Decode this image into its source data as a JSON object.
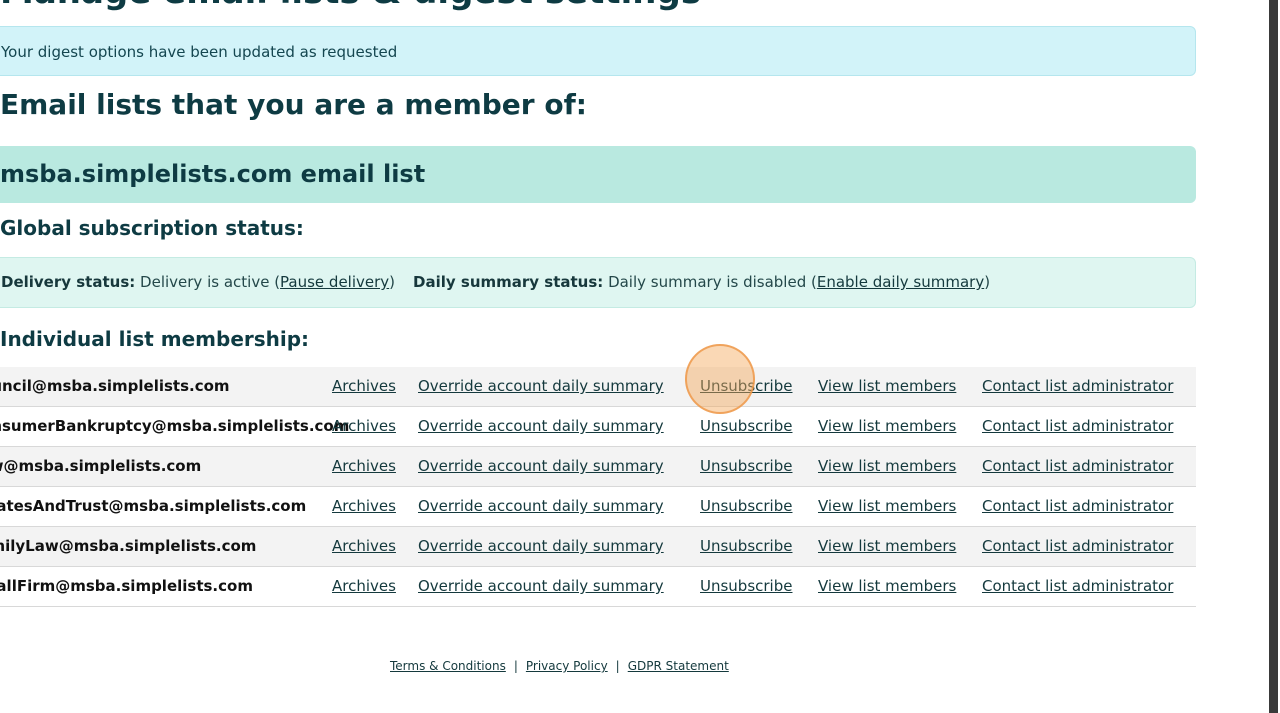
{
  "header": {
    "title_partial": "Manage email lists & digest settings"
  },
  "alert": {
    "text": "Your digest options have been updated as requested"
  },
  "sections": {
    "lists_heading": "Email lists that you are a member of:",
    "list_banner": "msba.simplelists.com email list",
    "subscription_heading": "Global subscription status:",
    "membership_heading": "Individual list membership:"
  },
  "status": {
    "delivery_label": "Delivery status:",
    "delivery_text": "Delivery is active",
    "pause_link": "Pause delivery",
    "summary_label": "Daily summary status:",
    "summary_text": "Daily summary is disabled",
    "enable_link": "Enable daily summary"
  },
  "rows": [
    {
      "email": "Council@msba.simplelists.com",
      "archives": "Archives",
      "override": "Override account daily summary",
      "unsubscribe": "Unsubscribe",
      "view": "View list members",
      "contact": "Contact list administrator"
    },
    {
      "email": "ConsumerBankruptcy@msba.simplelists.com",
      "archives": "Archives",
      "override": "Override account daily summary",
      "unsubscribe": "Unsubscribe",
      "view": "View list members",
      "contact": "Contact list administrator"
    },
    {
      "email": "Law@msba.simplelists.com",
      "archives": "Archives",
      "override": "Override account daily summary",
      "unsubscribe": "Unsubscribe",
      "view": "View list members",
      "contact": "Contact list administrator"
    },
    {
      "email": "EstatesAndTrust@msba.simplelists.com",
      "archives": "Archives",
      "override": "Override account daily summary",
      "unsubscribe": "Unsubscribe",
      "view": "View list members",
      "contact": "Contact list administrator"
    },
    {
      "email": "FamilyLaw@msba.simplelists.com",
      "archives": "Archives",
      "override": "Override account daily summary",
      "unsubscribe": "Unsubscribe",
      "view": "View list members",
      "contact": "Contact list administrator"
    },
    {
      "email": "SmallFirm@msba.simplelists.com",
      "archives": "Archives",
      "override": "Override account daily summary",
      "unsubscribe": "Unsubscribe",
      "view": "View list members",
      "contact": "Contact list administrator"
    }
  ],
  "footer": {
    "terms": "Terms & Conditions",
    "privacy": "Privacy Policy",
    "gdpr": "GDPR Statement",
    "separator": "|"
  },
  "colors": {
    "alert_bg": "#d2f3f9",
    "banner_bg": "#b9e9e0",
    "status_bg": "#dff6f1",
    "heading": "#0e3b43",
    "cursor_highlight": "#f5a85a"
  }
}
